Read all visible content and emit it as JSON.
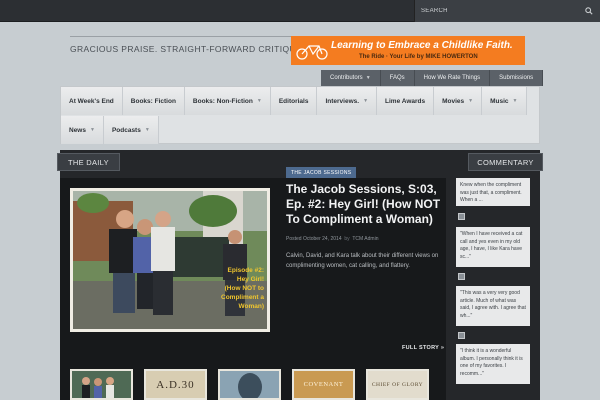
{
  "search": {
    "placeholder": "SEARCH"
  },
  "header": {
    "tagline": "GRACIOUS PRAISE. STRAIGHT-FORWARD CRITIQUE.",
    "ad": {
      "line1": "Learning to Embrace a Childlike Faith.",
      "line2": "The Ride  ·  Your Life  by  MIKE HOWERTON"
    }
  },
  "subnav": {
    "items": [
      {
        "label": "Contributors",
        "has_dropdown": true
      },
      {
        "label": "FAQs"
      },
      {
        "label": "How We Rate Things"
      },
      {
        "label": "Submissions"
      }
    ]
  },
  "mainnav": {
    "row1": [
      {
        "label": "At Week's End"
      },
      {
        "label": "Books: Fiction"
      },
      {
        "label": "Books: Non-Fiction",
        "has_dropdown": true
      },
      {
        "label": "Editorials"
      },
      {
        "label": "Interviews.",
        "has_dropdown": true
      },
      {
        "label": "Lime Awards"
      },
      {
        "label": "Movies",
        "has_dropdown": true
      },
      {
        "label": "Music",
        "has_dropdown": true
      }
    ],
    "row2": [
      {
        "label": "News",
        "has_dropdown": true
      },
      {
        "label": "Podcasts",
        "has_dropdown": true
      }
    ]
  },
  "tabs": {
    "daily": "THE DAILY",
    "commentary": "COMMENTARY"
  },
  "featured": {
    "tag": "THE JACOB SESSIONS",
    "title": "The Jacob Sessions, S:03, Ep. #2: Hey Girl! (How NOT To Compliment a Woman)",
    "date": "Posted  October 24, 2014",
    "by": "by",
    "author": "TCM Admin",
    "excerpt": "Calvin, David, and Kara talk about their different views on complimenting women, cat calling, and flattery.",
    "image_caption": "Episode #2:\nHey Girl!\n(How NOT to\nCompliment a\nWoman)",
    "full_story": "FULL STORY »"
  },
  "thumbnails": [
    {
      "name": "thumb-1",
      "text": ""
    },
    {
      "name": "thumb-2",
      "text": "A.D.30"
    },
    {
      "name": "thumb-3",
      "text": ""
    },
    {
      "name": "thumb-4",
      "text": "COVENANT"
    },
    {
      "name": "thumb-5",
      "text": "CHIEF OF GLORY"
    }
  ],
  "comments": [
    {
      "text": "Knew when the compliment was just that, a compliment. When a ..."
    },
    {
      "text": "\"When I have received a cat call and yes even in my old age, I have, I like Kara have sc...\""
    },
    {
      "text": "\"This was a very very good article. Much of what was said, I agree with. I agree that wh...\""
    },
    {
      "text": "\"I think it is a wonderful album. I personally think it is one of my favorites. I recomm...\""
    }
  ],
  "colors": {
    "accent": "#f47c20",
    "tag_bg": "#4d6a8f",
    "content_bg": "#17191b",
    "page_bg": "#c7cdd1"
  }
}
